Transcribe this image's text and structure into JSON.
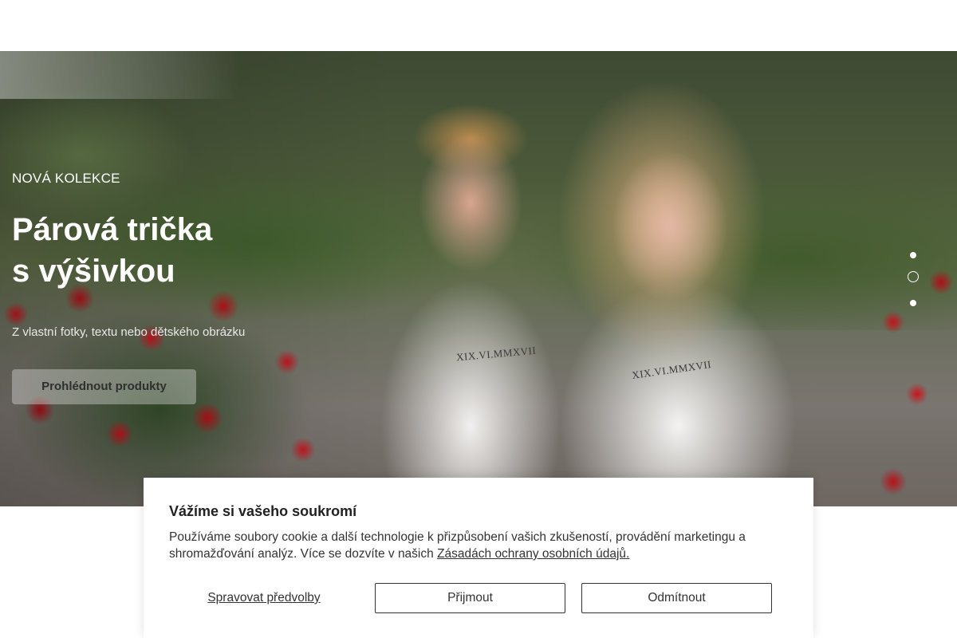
{
  "hero": {
    "eyebrow": "NOVÁ KOLEKCE",
    "title_line1": "Párová trička",
    "title_line2": "s výšivkou",
    "subtitle": "Z vlastní fotky, textu nebo dětského obrázku",
    "cta_label": "Prohlédnout produkty",
    "shirt_print_text": "XIX.VI.MMXVII",
    "slider": {
      "dot_count": 3,
      "active_index": 1
    }
  },
  "cookie_banner": {
    "title": "Vážíme si vašeho soukromí",
    "text": "Používáme soubory cookie a další technologie k přizpůsobení vašich zkušeností, provádění marketingu a shromažďování analýz. Více se dozvíte v našich",
    "link_text": "Zásadách ochrany osobních údajů.",
    "manage_label": "Spravovat předvolby",
    "accept_label": "Přijmout",
    "reject_label": "Odmítnout"
  }
}
